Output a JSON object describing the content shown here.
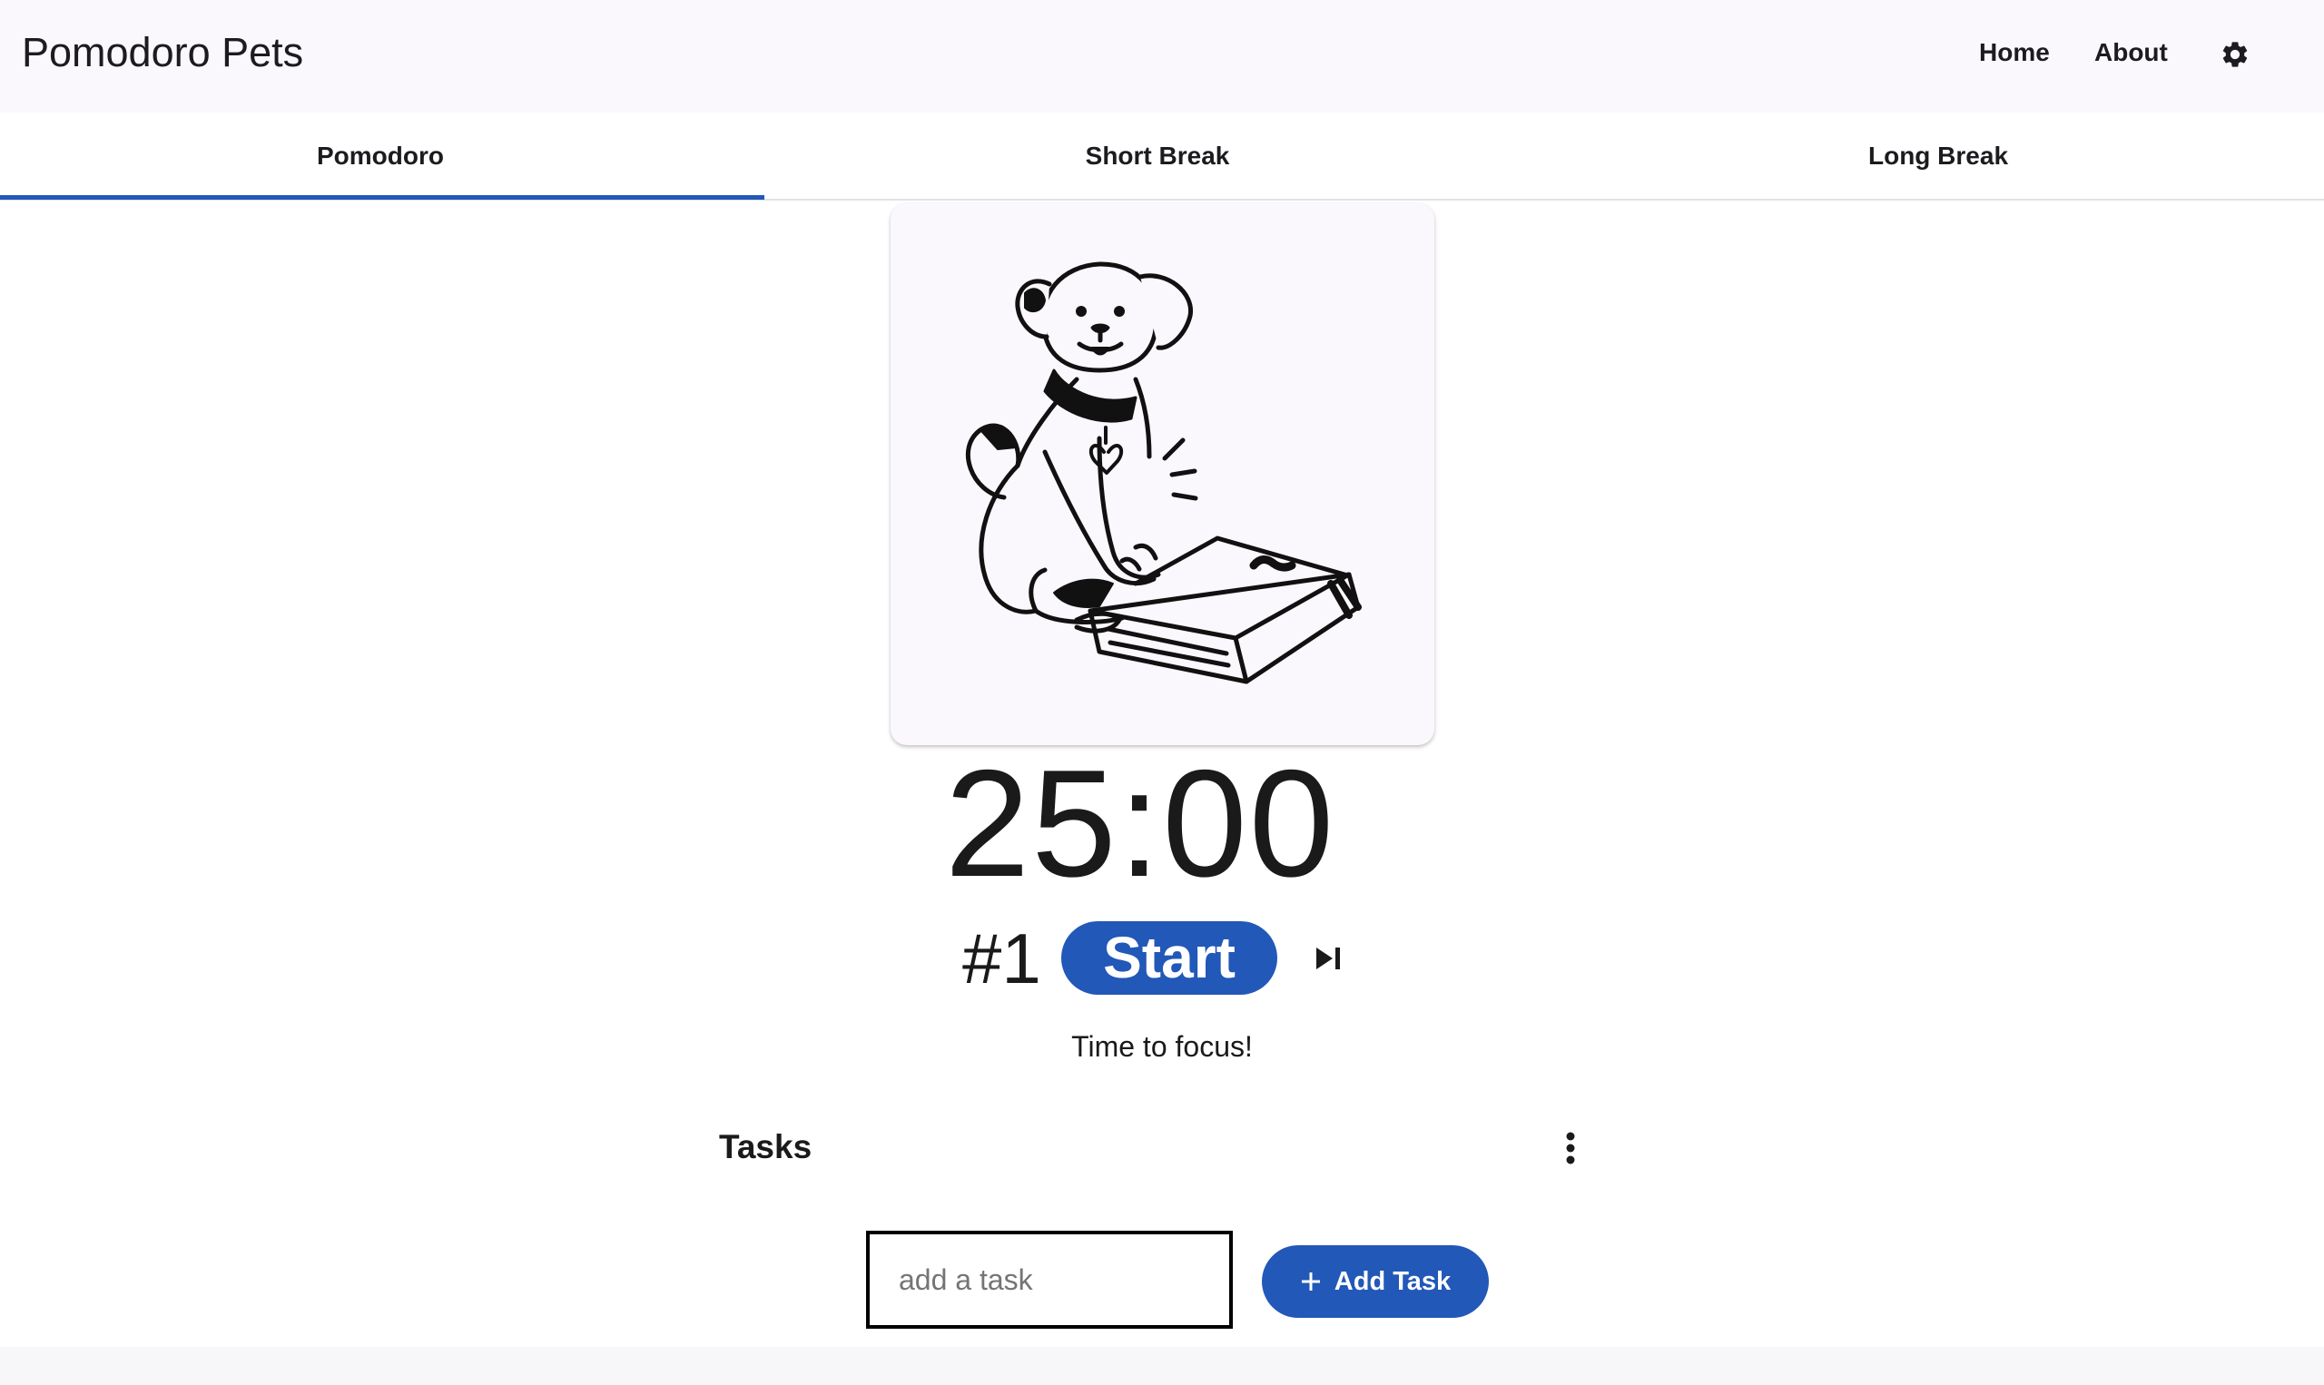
{
  "app": {
    "title": "Pomodoro Pets"
  },
  "nav": {
    "home_label": "Home",
    "about_label": "About",
    "settings_icon": "gear-icon"
  },
  "tabs": [
    {
      "label": "Pomodoro",
      "selected": true
    },
    {
      "label": "Short Break",
      "selected": false
    },
    {
      "label": "Long Break",
      "selected": false
    }
  ],
  "pet": {
    "image": "dog-on-book-illustration"
  },
  "timer": {
    "display": "25:00",
    "session_number": "#1",
    "start_label": "Start",
    "skip_icon": "skip-next-icon",
    "status": "Time to focus!"
  },
  "tasks": {
    "heading": "Tasks",
    "menu_icon": "more-vert-icon",
    "input_placeholder": "add a task",
    "input_value": "",
    "add_button_label": "Add Task",
    "add_icon": "plus-icon"
  },
  "colors": {
    "accent": "#2258b8",
    "app_bar_background": "#fbf8fd",
    "card_background": "#fbf8fd",
    "text": "#1c1b1f"
  }
}
